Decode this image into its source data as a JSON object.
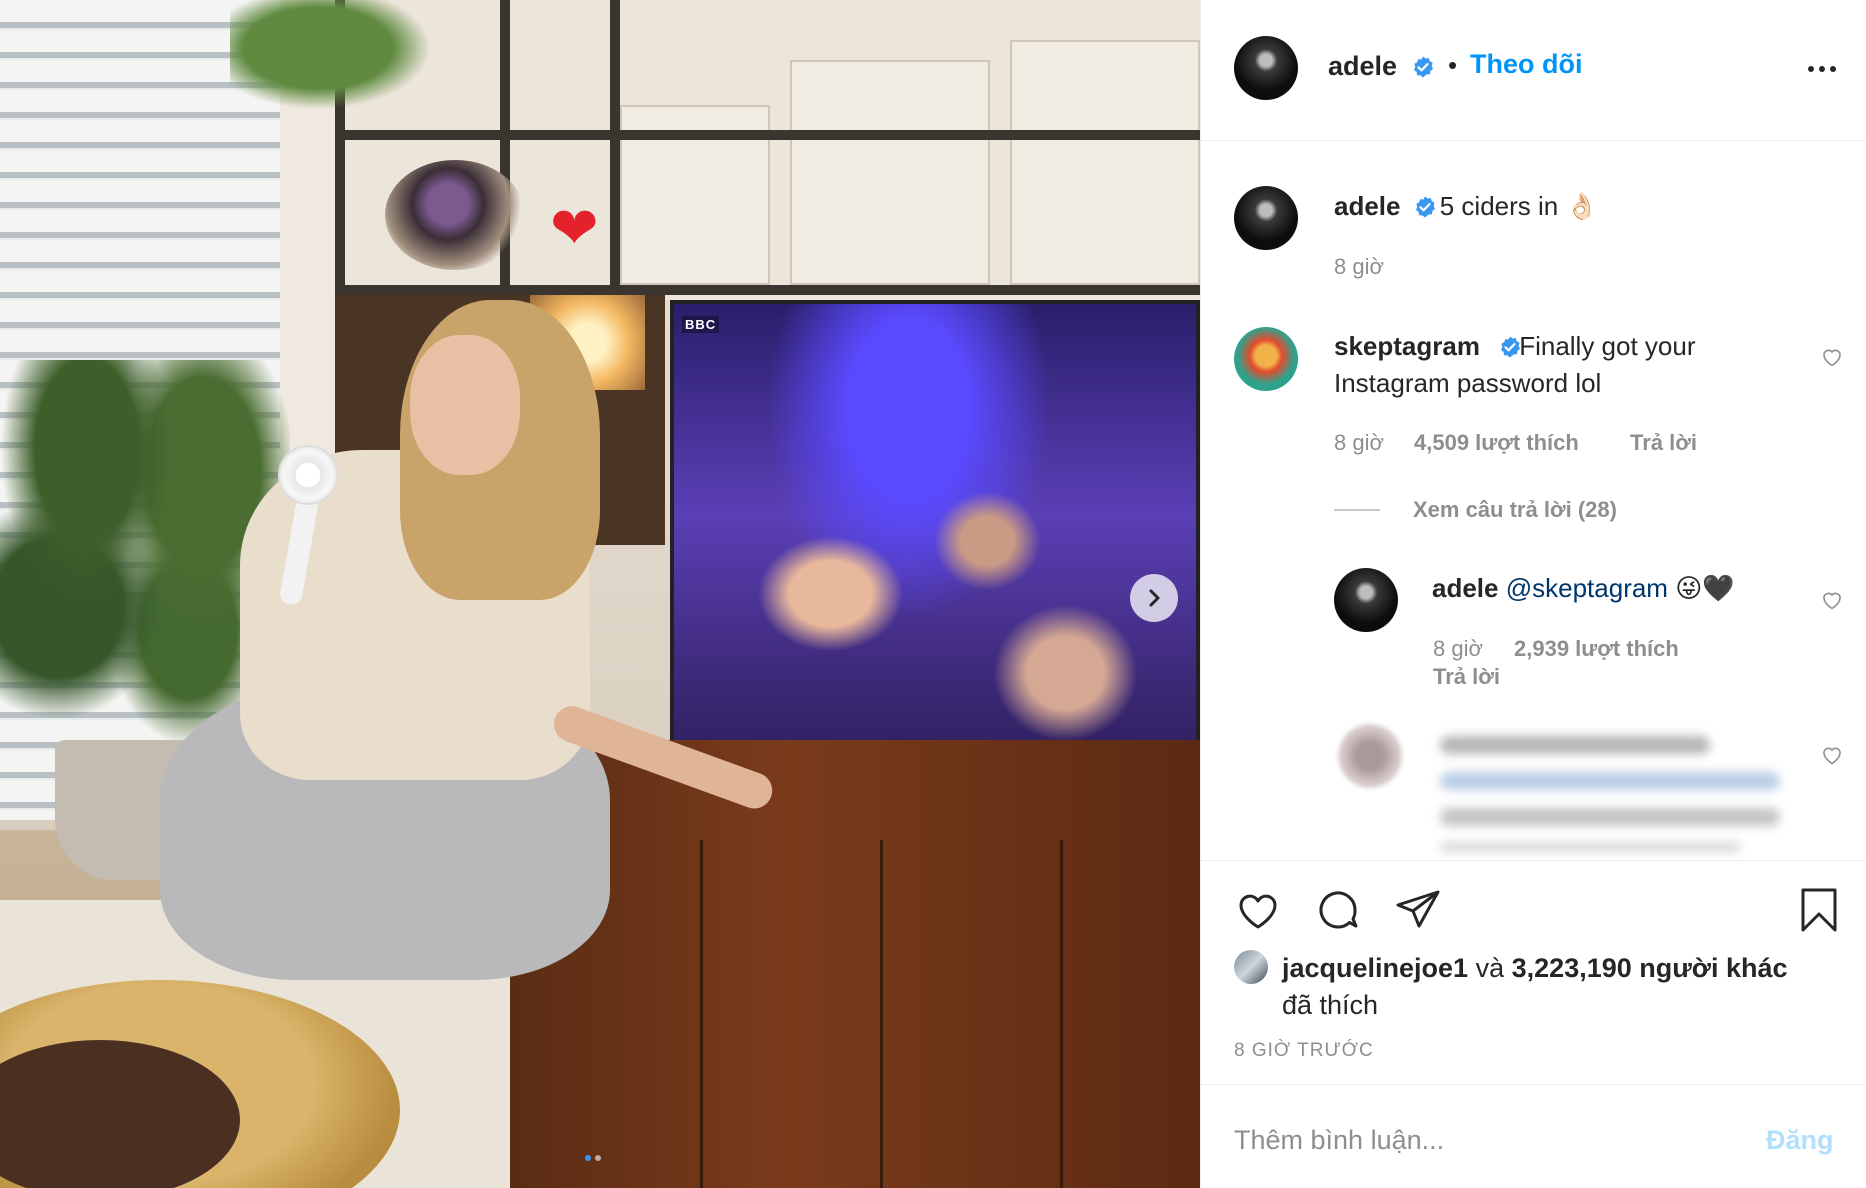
{
  "media": {
    "tv_logo": "BBC",
    "carousel_total": 2,
    "carousel_active": 1
  },
  "header": {
    "username": "adele",
    "separator": "•",
    "follow_label": "Theo dõi"
  },
  "caption": {
    "username": "adele",
    "text": "5 ciders in 👌🏻",
    "time": "8 giờ"
  },
  "comments": [
    {
      "username": "skeptagram",
      "text": "Finally got your Instagram password lol",
      "time": "8 giờ",
      "likes": "4,509 lượt thích",
      "reply_label": "Trả lời",
      "view_replies": "Xem câu trả lời (28)"
    }
  ],
  "reply": {
    "username": "adele",
    "mention": "@skeptagram",
    "emoji": "😜🖤",
    "time": "8 giờ",
    "likes": "2,939 lượt thích",
    "reply_label": "Trả lời"
  },
  "likes": {
    "first_user": "jacquelinejoe1",
    "connector": "và",
    "others": "3,223,190 người khác",
    "suffix": "đã thích"
  },
  "time_ago": "8 GIỜ TRƯỚC",
  "add_comment": {
    "placeholder": "Thêm bình luận...",
    "post_label": "Đăng"
  },
  "colors": {
    "link_blue": "#0095f6",
    "verified_blue": "#3897f0",
    "muted_gray": "#8e8e8e",
    "post_disabled": "#b2dffc"
  }
}
